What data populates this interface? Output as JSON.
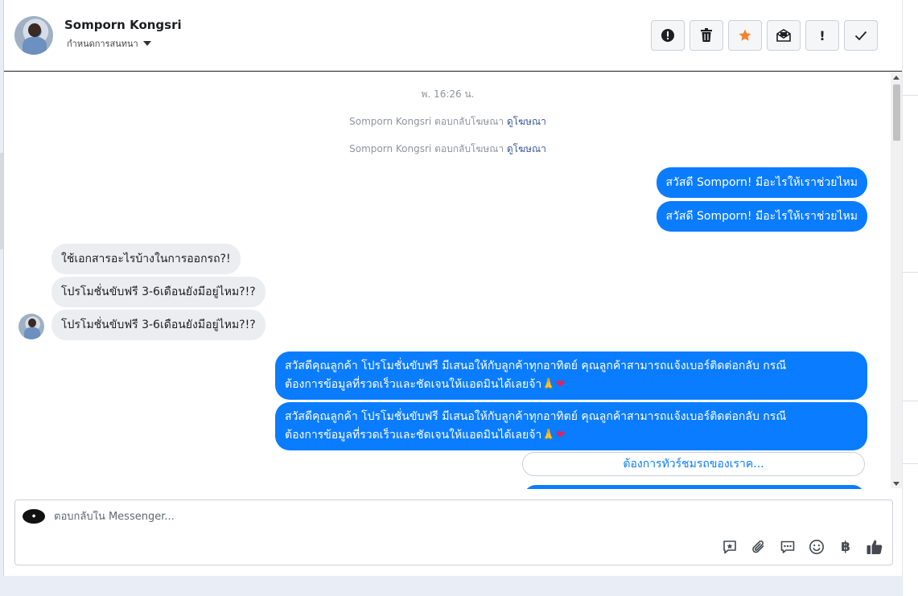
{
  "header": {
    "contact_name": "Somporn Kongsri",
    "conversation_settings": "กำหนดการสนทนา"
  },
  "toolbar": {
    "buttons": [
      {
        "name": "mark-spam",
        "icon": "alert-circle-icon"
      },
      {
        "name": "delete",
        "icon": "trash-icon"
      },
      {
        "name": "star",
        "icon": "star-icon",
        "color": "#f5822a"
      },
      {
        "name": "mark-unread",
        "icon": "envelope-icon"
      },
      {
        "name": "follow-up",
        "icon": "exclamation-icon"
      },
      {
        "name": "mark-done",
        "icon": "check-icon"
      }
    ]
  },
  "chat": {
    "timestamp": "พ. 16:26 น.",
    "system_messages": [
      {
        "prefix": "Somporn Kongsri ตอบกลับโฆษณา ",
        "link": "ดูโฆษณา"
      },
      {
        "prefix": "Somporn Kongsri ตอบกลับโฆษณา ",
        "link": "ดูโฆษณา"
      }
    ],
    "outgoing_greetings": [
      "สวัสดี Somporn! มีอะไรให้เราช่วยไหม",
      "สวัสดี Somporn! มีอะไรให้เราช่วยไหม"
    ],
    "incoming": [
      "ใช้เอกสารอะไรบ้างในการออกรถ?!",
      "โปรโมชั่นขับฟรี 3-6เดือนยังมีอยู่ไหม?!?",
      "โปรโมชั่นขับฟรี 3-6เดือนยังมีอยู่ไหม?!?"
    ],
    "outgoing_replies": [
      {
        "line1": "สวัสดีคุณลูกค้า โปรโมชั่นขับฟรี มีเสนอให้กับลูกค้าทุกอาทิตย์ คุณลูกค้าสามารถแจ้งเบอร์ติดต่อกลับ กรณี",
        "line2": "ต้องการข้อมูลที่รวดเร็วและชัดเจนให้แอดมินได้เลยจ้า",
        "emoji_hands": "🙏",
        "emoji_heart": "❤"
      },
      {
        "line1": "สวัสดีคุณลูกค้า โปรโมชั่นขับฟรี มีเสนอให้กับลูกค้าทุกอาทิตย์ คุณลูกค้าสามารถแจ้งเบอร์ติดต่อกลับ กรณี",
        "line2": "ต้องการข้อมูลที่รวดเร็วและชัดเจนให้แอดมินได้เลยจ้า",
        "emoji_hands": "🙏",
        "emoji_heart": "❤"
      }
    ],
    "quick_reply": "ต้องการทัวร์ชมรถของเราค..."
  },
  "composer": {
    "placeholder": "ตอบกลับใน Messenger...",
    "icons": [
      "saved-reply-icon",
      "attachment-icon",
      "message-icon",
      "emoji-icon",
      "baht-icon",
      "thumbs-up-icon"
    ]
  },
  "colors": {
    "outgoing_bubble": "#0a7cff",
    "incoming_bubble": "#ebedf0",
    "star": "#f5822a"
  }
}
